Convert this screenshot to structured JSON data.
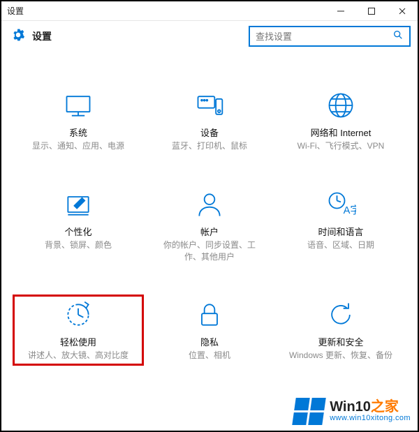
{
  "window": {
    "title": "设置"
  },
  "header": {
    "title": "设置"
  },
  "search": {
    "placeholder": "查找设置"
  },
  "tiles": [
    {
      "title": "系统",
      "desc": "显示、通知、应用、电源"
    },
    {
      "title": "设备",
      "desc": "蓝牙、打印机、鼠标"
    },
    {
      "title": "网络和 Internet",
      "desc": "Wi-Fi、飞行模式、VPN"
    },
    {
      "title": "个性化",
      "desc": "背景、锁屏、颜色"
    },
    {
      "title": "帐户",
      "desc": "你的帐户、同步设置、工作、其他用户"
    },
    {
      "title": "时间和语言",
      "desc": "语音、区域、日期"
    },
    {
      "title": "轻松使用",
      "desc": "讲述人、放大镜、高对比度"
    },
    {
      "title": "隐私",
      "desc": "位置、相机"
    },
    {
      "title": "更新和安全",
      "desc": "Windows 更新、恢复、备份"
    }
  ],
  "watermark": {
    "brand_a": "Win10",
    "brand_b": "之家",
    "url": "www.win10xitong.com"
  }
}
